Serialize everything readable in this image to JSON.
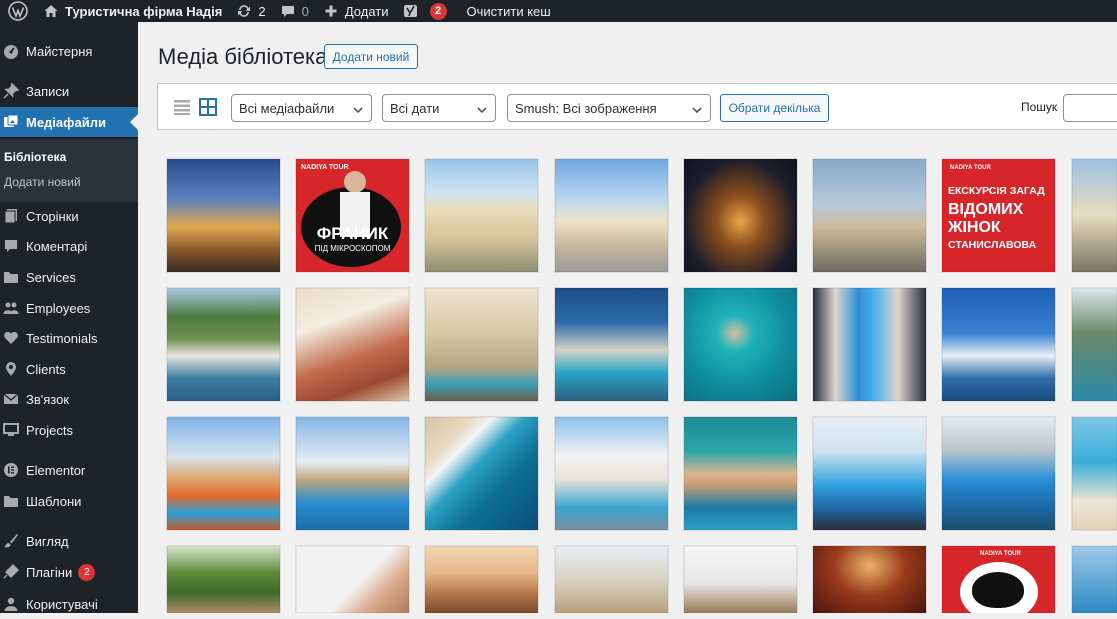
{
  "adminbar": {
    "site_name": "Туристична фірма Надія",
    "updates_count": "2",
    "comments_count": "0",
    "add_new": "Додати",
    "yoast_count": "2",
    "clear_cache": "Очистити кеш"
  },
  "sidebar": {
    "items": [
      {
        "label": "Майстерня",
        "icon": "dashboard-icon"
      },
      {
        "label": "Записи",
        "icon": "pin-icon"
      },
      {
        "label": "Медіафайли",
        "icon": "media-icon"
      },
      {
        "label": "Сторінки",
        "icon": "pages-icon"
      },
      {
        "label": "Коментарі",
        "icon": "comment-icon"
      },
      {
        "label": "Services",
        "icon": "folder-icon"
      },
      {
        "label": "Employees",
        "icon": "users-icon"
      },
      {
        "label": "Testimonials",
        "icon": "heart-icon"
      },
      {
        "label": "Clients",
        "icon": "location-icon"
      },
      {
        "label": "Зв'язок",
        "icon": "mail-icon"
      },
      {
        "label": "Projects",
        "icon": "monitor-icon"
      },
      {
        "label": "Elementor",
        "icon": "elementor-icon"
      },
      {
        "label": "Шаблони",
        "icon": "folder-icon"
      },
      {
        "label": "Вигляд",
        "icon": "brush-icon"
      },
      {
        "label": "Плагіни",
        "icon": "plugin-icon",
        "badge": "2"
      },
      {
        "label": "Користувачі",
        "icon": "user-icon"
      }
    ],
    "submenu": [
      "Бібліотека",
      "Додати новий"
    ]
  },
  "page": {
    "title": "Медіа бібліотека",
    "add_new_button": "Додати новий"
  },
  "toolbar": {
    "filter_media": "Всі медіафайли",
    "filter_dates": "Всі дати",
    "filter_smush": "Smush: Всі зображення",
    "bulk_select": "Обрати декілька",
    "search_label": "Пошук",
    "search_value": ""
  },
  "grid": {
    "poster_1_small": "NADIYA TOUR",
    "poster_1_title": "ФРАНИК",
    "poster_1_sub": "ПІД МІКРОСКОПОМ",
    "poster_2_small": "NADIYA TOUR",
    "poster_2_line1": "ЕКСКУРСІЯ ЗАГАД",
    "poster_2_line2": "ВІДОМИХ",
    "poster_2_line3": "ЖІНОК",
    "poster_2_line4": "СТАНИСЛАВОВА",
    "poster_3_small": "NADIYA TOUR"
  },
  "colors": {
    "adminbar_bg": "#1d2327",
    "accent": "#2271b1",
    "badge": "#d63638",
    "poster_red": "#d7262a"
  }
}
